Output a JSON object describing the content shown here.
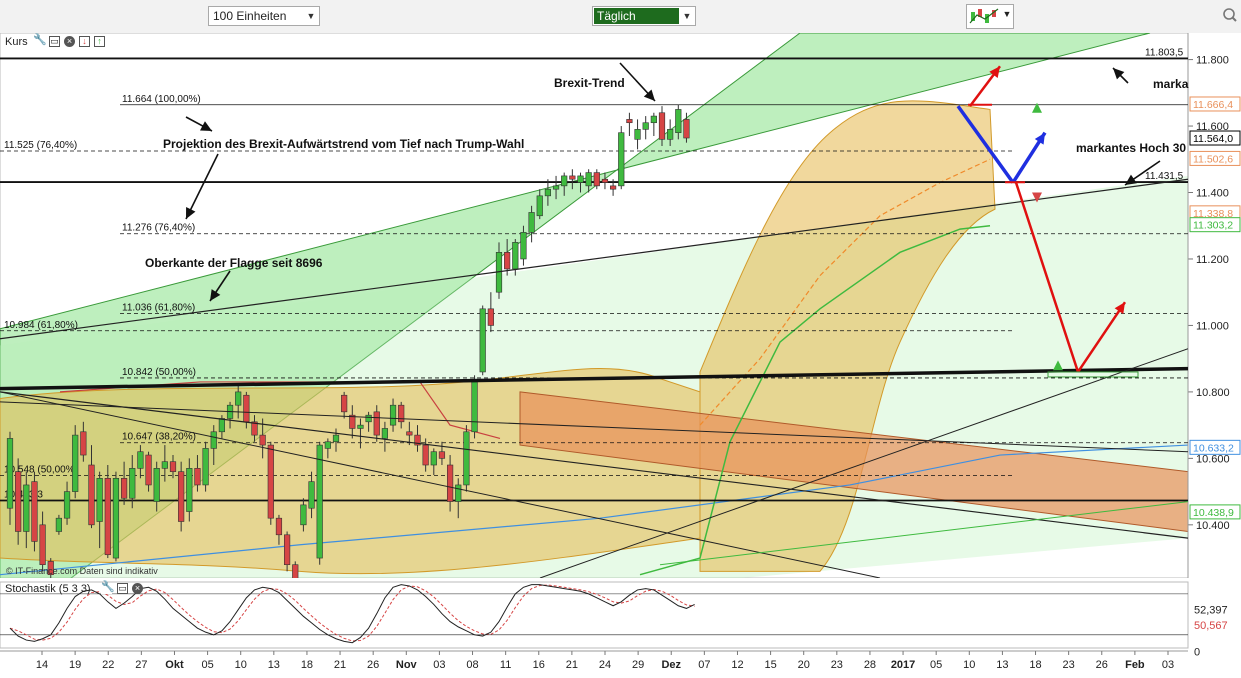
{
  "toolbar": {
    "units_select": "100 Einheiten",
    "interval_select": "Täglich",
    "chart_type_icon": "candlestick-chart-icon",
    "zoom_icon": "magnifier-icon"
  },
  "panels": {
    "main_title": "Kurs",
    "stoch_title": "Stochastik (5 3 3)",
    "watermark": "© IT-Finance.com  Daten sind indikativ"
  },
  "colors": {
    "bull": "#3fba3f",
    "bear": "#d64545",
    "trend_channel": "#6fdc6f",
    "bollinger": "#e6b84d",
    "flag": "#e8905a",
    "blue_arrow": "#1f2fe0",
    "red_arrow": "#e01010"
  },
  "annotations": {
    "brexit_trend": "Brexit-Trend",
    "projection": "Projektion des  Brexit-Aufwärtstrend vom Tief nach Trump-Wahl",
    "flag_top": "Oberkante der Flagge seit 8696",
    "marka": "marka",
    "markantes_hoch": "markantes Hoch 30"
  },
  "chart_data": {
    "type": "candlestick",
    "y_axis": {
      "range": [
        10240,
        11880
      ],
      "ticks": [
        "11.800",
        "11.600",
        "11.400",
        "11.200",
        "11.000",
        "10.800",
        "10.600",
        "10.400"
      ],
      "tick_values": [
        11800,
        11600,
        11400,
        11200,
        11000,
        10800,
        10600,
        10400
      ]
    },
    "price_labels": [
      {
        "value": 11666.4,
        "text": "11.666,4",
        "color": "#e8905a"
      },
      {
        "value": 11564.0,
        "text": "11.564,0",
        "color": "#000000"
      },
      {
        "value": 11502.6,
        "text": "11.502,6",
        "color": "#e8905a"
      },
      {
        "value": 11338.8,
        "text": "11.338,8",
        "color": "#e8905a"
      },
      {
        "value": 11303.2,
        "text": "11.303,2",
        "color": "#3fba3f"
      },
      {
        "value": 10633.2,
        "text": "10.633,2",
        "color": "#3f8fe0"
      },
      {
        "value": 10438.9,
        "text": "10.438,9",
        "color": "#3fba3f"
      }
    ],
    "levels": [
      {
        "value": 11803.5,
        "text": "11.803,5",
        "style": "solid"
      },
      {
        "value": 11664,
        "text": "11.664 (100,00%)",
        "style": "solid-thin"
      },
      {
        "value": 11525,
        "text": "11.525 (76,40%)",
        "style": "dashed"
      },
      {
        "value": 11431.5,
        "text": "11.431,5",
        "style": "solid"
      },
      {
        "value": 11276,
        "text": "11.276 (76,40%)",
        "style": "dashed"
      },
      {
        "value": 11036,
        "text": "11.036 (61,80%)",
        "style": "dashed"
      },
      {
        "value": 10984,
        "text": "10.984 (61,80%)",
        "style": "dashed"
      },
      {
        "value": 10842,
        "text": "10.842 (50,00%)",
        "style": "dashed"
      },
      {
        "value": 10647,
        "text": "10.647 (38,20%)",
        "style": "dashed"
      },
      {
        "value": 10548,
        "text": "10.548 (50,00%)",
        "style": "dashed"
      },
      {
        "value": 10473.3,
        "text": "10.473,3",
        "style": "solid"
      }
    ],
    "x_axis": {
      "labels": [
        {
          "text": "14",
          "bold": false
        },
        {
          "text": "19",
          "bold": false
        },
        {
          "text": "22",
          "bold": false
        },
        {
          "text": "27",
          "bold": false
        },
        {
          "text": "Okt",
          "bold": true
        },
        {
          "text": "05",
          "bold": false
        },
        {
          "text": "10",
          "bold": false
        },
        {
          "text": "13",
          "bold": false
        },
        {
          "text": "18",
          "bold": false
        },
        {
          "text": "21",
          "bold": false
        },
        {
          "text": "26",
          "bold": false
        },
        {
          "text": "Nov",
          "bold": true
        },
        {
          "text": "03",
          "bold": false
        },
        {
          "text": "08",
          "bold": false
        },
        {
          "text": "11",
          "bold": false
        },
        {
          "text": "16",
          "bold": false
        },
        {
          "text": "21",
          "bold": false
        },
        {
          "text": "24",
          "bold": false
        },
        {
          "text": "29",
          "bold": false
        },
        {
          "text": "Dez",
          "bold": true
        },
        {
          "text": "07",
          "bold": false
        },
        {
          "text": "12",
          "bold": false
        },
        {
          "text": "15",
          "bold": false
        },
        {
          "text": "20",
          "bold": false
        },
        {
          "text": "23",
          "bold": false
        },
        {
          "text": "28",
          "bold": false
        },
        {
          "text": "2017",
          "bold": true
        },
        {
          "text": "05",
          "bold": false
        },
        {
          "text": "10",
          "bold": false
        },
        {
          "text": "13",
          "bold": false
        },
        {
          "text": "18",
          "bold": false
        },
        {
          "text": "23",
          "bold": false
        },
        {
          "text": "26",
          "bold": false
        },
        {
          "text": "Feb",
          "bold": true
        },
        {
          "text": "03",
          "bold": false
        }
      ]
    },
    "candles": [
      {
        "o": 10450,
        "h": 10680,
        "l": 10400,
        "c": 10660
      },
      {
        "o": 10560,
        "h": 10600,
        "l": 10340,
        "c": 10380
      },
      {
        "o": 10380,
        "h": 10560,
        "l": 10330,
        "c": 10520
      },
      {
        "o": 10530,
        "h": 10560,
        "l": 10320,
        "c": 10350
      },
      {
        "o": 10400,
        "h": 10440,
        "l": 10260,
        "c": 10280
      },
      {
        "o": 10290,
        "h": 10300,
        "l": 10200,
        "c": 10250
      },
      {
        "o": 10380,
        "h": 10430,
        "l": 10370,
        "c": 10420
      },
      {
        "o": 10420,
        "h": 10530,
        "l": 10400,
        "c": 10500
      },
      {
        "o": 10500,
        "h": 10700,
        "l": 10480,
        "c": 10670
      },
      {
        "o": 10680,
        "h": 10710,
        "l": 10590,
        "c": 10610
      },
      {
        "o": 10580,
        "h": 10640,
        "l": 10390,
        "c": 10400
      },
      {
        "o": 10410,
        "h": 10560,
        "l": 10330,
        "c": 10540
      },
      {
        "o": 10540,
        "h": 10580,
        "l": 10300,
        "c": 10310
      },
      {
        "o": 10300,
        "h": 10560,
        "l": 10290,
        "c": 10540
      },
      {
        "o": 10540,
        "h": 10590,
        "l": 10460,
        "c": 10480
      },
      {
        "o": 10480,
        "h": 10610,
        "l": 10450,
        "c": 10570
      },
      {
        "o": 10570,
        "h": 10640,
        "l": 10540,
        "c": 10620
      },
      {
        "o": 10610,
        "h": 10620,
        "l": 10500,
        "c": 10520
      },
      {
        "o": 10470,
        "h": 10590,
        "l": 10440,
        "c": 10570
      },
      {
        "o": 10570,
        "h": 10640,
        "l": 10530,
        "c": 10590
      },
      {
        "o": 10590,
        "h": 10610,
        "l": 10540,
        "c": 10560
      },
      {
        "o": 10560,
        "h": 10590,
        "l": 10380,
        "c": 10410
      },
      {
        "o": 10440,
        "h": 10600,
        "l": 10410,
        "c": 10570
      },
      {
        "o": 10570,
        "h": 10610,
        "l": 10500,
        "c": 10520
      },
      {
        "o": 10520,
        "h": 10650,
        "l": 10500,
        "c": 10630
      },
      {
        "o": 10630,
        "h": 10700,
        "l": 10580,
        "c": 10680
      },
      {
        "o": 10680,
        "h": 10730,
        "l": 10660,
        "c": 10720
      },
      {
        "o": 10720,
        "h": 10770,
        "l": 10690,
        "c": 10760
      },
      {
        "o": 10760,
        "h": 10820,
        "l": 10720,
        "c": 10800
      },
      {
        "o": 10790,
        "h": 10800,
        "l": 10690,
        "c": 10710
      },
      {
        "o": 10710,
        "h": 10730,
        "l": 10650,
        "c": 10670
      },
      {
        "o": 10670,
        "h": 10720,
        "l": 10600,
        "c": 10640
      },
      {
        "o": 10640,
        "h": 10650,
        "l": 10400,
        "c": 10420
      },
      {
        "o": 10420,
        "h": 10430,
        "l": 10340,
        "c": 10370
      },
      {
        "o": 10370,
        "h": 10380,
        "l": 10260,
        "c": 10280
      },
      {
        "o": 10280,
        "h": 10290,
        "l": 10190,
        "c": 10220
      },
      {
        "o": 10400,
        "h": 10480,
        "l": 10380,
        "c": 10460
      },
      {
        "o": 10450,
        "h": 10560,
        "l": 10420,
        "c": 10530
      },
      {
        "o": 10300,
        "h": 10650,
        "l": 10280,
        "c": 10640
      },
      {
        "o": 10630,
        "h": 10660,
        "l": 10600,
        "c": 10650
      },
      {
        "o": 10650,
        "h": 10690,
        "l": 10620,
        "c": 10670
      },
      {
        "o": 10790,
        "h": 10800,
        "l": 10720,
        "c": 10740
      },
      {
        "o": 10730,
        "h": 10760,
        "l": 10660,
        "c": 10690
      },
      {
        "o": 10690,
        "h": 10720,
        "l": 10630,
        "c": 10700
      },
      {
        "o": 10710,
        "h": 10740,
        "l": 10680,
        "c": 10730
      },
      {
        "o": 10740,
        "h": 10760,
        "l": 10650,
        "c": 10670
      },
      {
        "o": 10660,
        "h": 10710,
        "l": 10620,
        "c": 10690
      },
      {
        "o": 10700,
        "h": 10780,
        "l": 10680,
        "c": 10760
      },
      {
        "o": 10760,
        "h": 10770,
        "l": 10690,
        "c": 10710
      },
      {
        "o": 10680,
        "h": 10710,
        "l": 10640,
        "c": 10670
      },
      {
        "o": 10670,
        "h": 10700,
        "l": 10620,
        "c": 10640
      },
      {
        "o": 10640,
        "h": 10660,
        "l": 10560,
        "c": 10580
      },
      {
        "o": 10580,
        "h": 10630,
        "l": 10550,
        "c": 10620
      },
      {
        "o": 10620,
        "h": 10650,
        "l": 10580,
        "c": 10600
      },
      {
        "o": 10580,
        "h": 10610,
        "l": 10440,
        "c": 10470
      },
      {
        "o": 10470,
        "h": 10540,
        "l": 10420,
        "c": 10520
      },
      {
        "o": 10520,
        "h": 10700,
        "l": 10500,
        "c": 10680
      },
      {
        "o": 10680,
        "h": 10850,
        "l": 10660,
        "c": 10830
      },
      {
        "o": 10860,
        "h": 11060,
        "l": 10850,
        "c": 11050
      },
      {
        "o": 11050,
        "h": 11100,
        "l": 10980,
        "c": 11000
      },
      {
        "o": 11100,
        "h": 11250,
        "l": 11080,
        "c": 11220
      },
      {
        "o": 11220,
        "h": 11260,
        "l": 11150,
        "c": 11170
      },
      {
        "o": 11170,
        "h": 11260,
        "l": 11150,
        "c": 11250
      },
      {
        "o": 11200,
        "h": 11300,
        "l": 11180,
        "c": 11280
      },
      {
        "o": 11280,
        "h": 11360,
        "l": 11250,
        "c": 11340
      },
      {
        "o": 11330,
        "h": 11410,
        "l": 11320,
        "c": 11390
      },
      {
        "o": 11390,
        "h": 11440,
        "l": 11360,
        "c": 11410
      },
      {
        "o": 11410,
        "h": 11450,
        "l": 11380,
        "c": 11420
      },
      {
        "o": 11420,
        "h": 11460,
        "l": 11390,
        "c": 11450
      },
      {
        "o": 11450,
        "h": 11470,
        "l": 11410,
        "c": 11440
      },
      {
        "o": 11430,
        "h": 11460,
        "l": 11400,
        "c": 11450
      },
      {
        "o": 11420,
        "h": 11470,
        "l": 11400,
        "c": 11460
      },
      {
        "o": 11460,
        "h": 11470,
        "l": 11410,
        "c": 11420
      },
      {
        "o": 11440,
        "h": 11460,
        "l": 11410,
        "c": 11430
      },
      {
        "o": 11420,
        "h": 11440,
        "l": 11390,
        "c": 11410
      },
      {
        "o": 11420,
        "h": 11600,
        "l": 11410,
        "c": 11580
      },
      {
        "o": 11620,
        "h": 11640,
        "l": 11570,
        "c": 11610
      },
      {
        "o": 11560,
        "h": 11620,
        "l": 11530,
        "c": 11590
      },
      {
        "o": 11590,
        "h": 11630,
        "l": 11560,
        "c": 11610
      },
      {
        "o": 11610,
        "h": 11640,
        "l": 11570,
        "c": 11630
      },
      {
        "o": 11640,
        "h": 11660,
        "l": 11540,
        "c": 11560
      },
      {
        "o": 11560,
        "h": 11620,
        "l": 11540,
        "c": 11590
      },
      {
        "o": 11580,
        "h": 11664,
        "l": 11560,
        "c": 11650
      },
      {
        "o": 11620,
        "h": 11640,
        "l": 11550,
        "c": 11564
      }
    ],
    "stochastic": {
      "title": "Stochastik (5 3 3)",
      "range": [
        0,
        100
      ],
      "ticks": [
        "52,397",
        "50,567",
        "0"
      ],
      "k": [
        30,
        18,
        12,
        10,
        14,
        20,
        38,
        60,
        78,
        86,
        88,
        82,
        70,
        60,
        68,
        78,
        90,
        92,
        86,
        74,
        60,
        50,
        40,
        30,
        24,
        20,
        26,
        40,
        58,
        76,
        88,
        92,
        90,
        84,
        72,
        60,
        48,
        38,
        28,
        20,
        14,
        10,
        8,
        16,
        30,
        52,
        76,
        92,
        96,
        94,
        88,
        78,
        66,
        52,
        40,
        32,
        26,
        20,
        18,
        24,
        40,
        62,
        82,
        92,
        96,
        96,
        94,
        92,
        90,
        88,
        86,
        82,
        76,
        70,
        64,
        70,
        80,
        88,
        90,
        88,
        80,
        72,
        64,
        60,
        66
      ]
    }
  }
}
